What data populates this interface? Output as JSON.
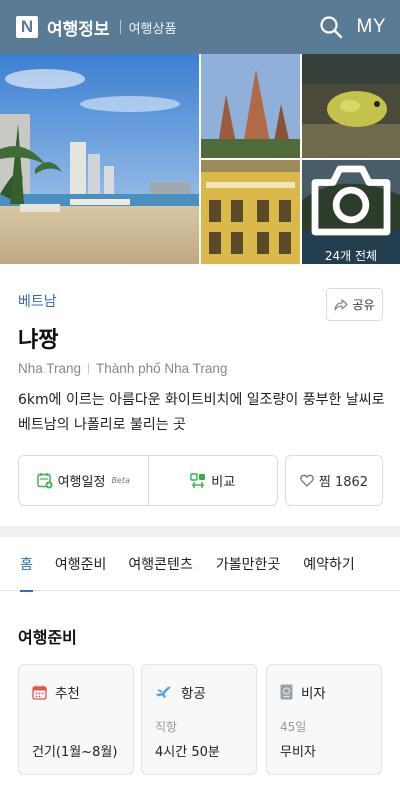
{
  "header": {
    "logo": "N",
    "brand": "여행정보",
    "sub": "여행상품",
    "my": "MY",
    "bg_color": "#5a7b95"
  },
  "gallery": {
    "all_label": "24개 전체"
  },
  "place": {
    "country": "베트남",
    "share_label": "공유",
    "name": "냐짱",
    "alt_name_1": "Nha Trang",
    "alt_name_2": "Thành phố Nha Trang",
    "description": "6km에 이르는 아름다운 화이트비치에 일조량이 풍부한 날씨로 베트남의 나폴리로 불리는 곳"
  },
  "actions": {
    "schedule_label": "여행일정",
    "beta": "Beta",
    "compare_label": "비교",
    "like_label": "찜 1862"
  },
  "tabs": [
    {
      "label": "홈"
    },
    {
      "label": "여행준비"
    },
    {
      "label": "여행콘텐츠"
    },
    {
      "label": "가볼만한곳"
    },
    {
      "label": "예약하기"
    }
  ],
  "prep": {
    "title": "여행준비",
    "cards": [
      {
        "icon": "calendar-icon",
        "title": "추천",
        "label": "",
        "value": "건기(1월~8월)"
      },
      {
        "icon": "airplane-icon",
        "title": "항공",
        "label": "직항",
        "value": "4시간 50분"
      },
      {
        "icon": "passport-icon",
        "title": "비자",
        "label": "45일",
        "value": "무비자"
      }
    ]
  },
  "colors": {
    "accent_blue": "#2d6fb8",
    "country_blue": "#3866c6",
    "green_icon": "#3bae4a"
  }
}
